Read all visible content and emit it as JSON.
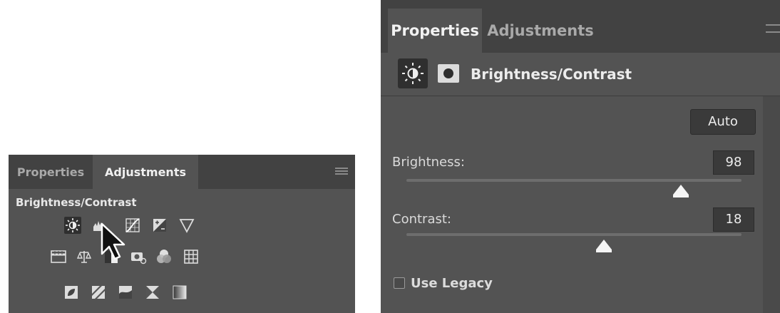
{
  "left_panel": {
    "tabs": [
      {
        "label": "Properties",
        "active": false
      },
      {
        "label": "Adjustments",
        "active": true
      }
    ],
    "section_title": "Brightness/Contrast",
    "icon_rows": [
      [
        "brightness-contrast-icon",
        "levels-icon",
        "curves-icon",
        "exposure-icon",
        "vibrance-icon"
      ],
      [
        "hue-saturation-icon",
        "color-balance-icon",
        "black-white-icon",
        "photo-filter-icon",
        "channel-mixer-icon",
        "color-lookup-icon"
      ],
      [
        "invert-icon",
        "posterize-icon",
        "threshold-icon",
        "selective-color-icon",
        "gradient-map-icon"
      ]
    ],
    "selected_icon": "brightness-contrast-icon"
  },
  "right_panel": {
    "tabs": [
      {
        "label": "Properties",
        "active": true
      },
      {
        "label": "Adjustments",
        "active": false
      }
    ],
    "header_title": "Brightness/Contrast",
    "auto_label": "Auto",
    "brightness": {
      "label": "Brightness:",
      "value": "98",
      "slider_fraction": 0.82
    },
    "contrast": {
      "label": "Contrast:",
      "value": "18",
      "slider_fraction": 0.59
    },
    "use_legacy": {
      "label": "Use Legacy",
      "checked": false
    }
  },
  "colors": {
    "panel_bg": "#535353",
    "tabbar_bg": "#424242",
    "field_bg": "#3a3a3a",
    "text": "#e0e0e0"
  }
}
